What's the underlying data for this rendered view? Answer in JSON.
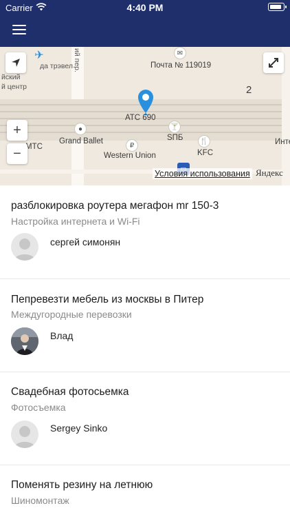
{
  "status_bar": {
    "carrier": "Carrier",
    "time": "4:40 PM",
    "battery_level": 0.9
  },
  "map": {
    "labels": {
      "travel": "да трэвел",
      "street": "ий пер.",
      "center_1": "йский",
      "center_2": "й центр",
      "post": "Почта № 119019",
      "number_2": "2",
      "ats": "АТС 690",
      "spb": "SПБ",
      "grand_ballet": "Grand Ballet",
      "mts": "МТС",
      "western_union": "Western Union",
      "kfc": "KFC",
      "inte": "Инте"
    },
    "terms": "Условия использования",
    "logo": "Яндекс"
  },
  "requests": [
    {
      "title": "разблокировка роутера мегафон mr 150-3",
      "category": "Настройка интернета и Wi-Fi",
      "user": "сергей симонян",
      "avatar": "placeholder"
    },
    {
      "title": "Пепревезти мебель из москвы в Питер",
      "category": "Междугородные перевозки",
      "user": "Влад",
      "avatar": "photo"
    },
    {
      "title": "Свадебная фотосьемка",
      "category": "Фотосъемка",
      "user": "Sergey Sinko",
      "avatar": "placeholder"
    },
    {
      "title": "Поменять резину на летнюю",
      "category": "Шиномонтаж",
      "user": "",
      "avatar": "placeholder"
    }
  ],
  "colors": {
    "header": "#1f2f6b",
    "map_bg": "#efe9df",
    "pin": "#2a8fdc"
  }
}
